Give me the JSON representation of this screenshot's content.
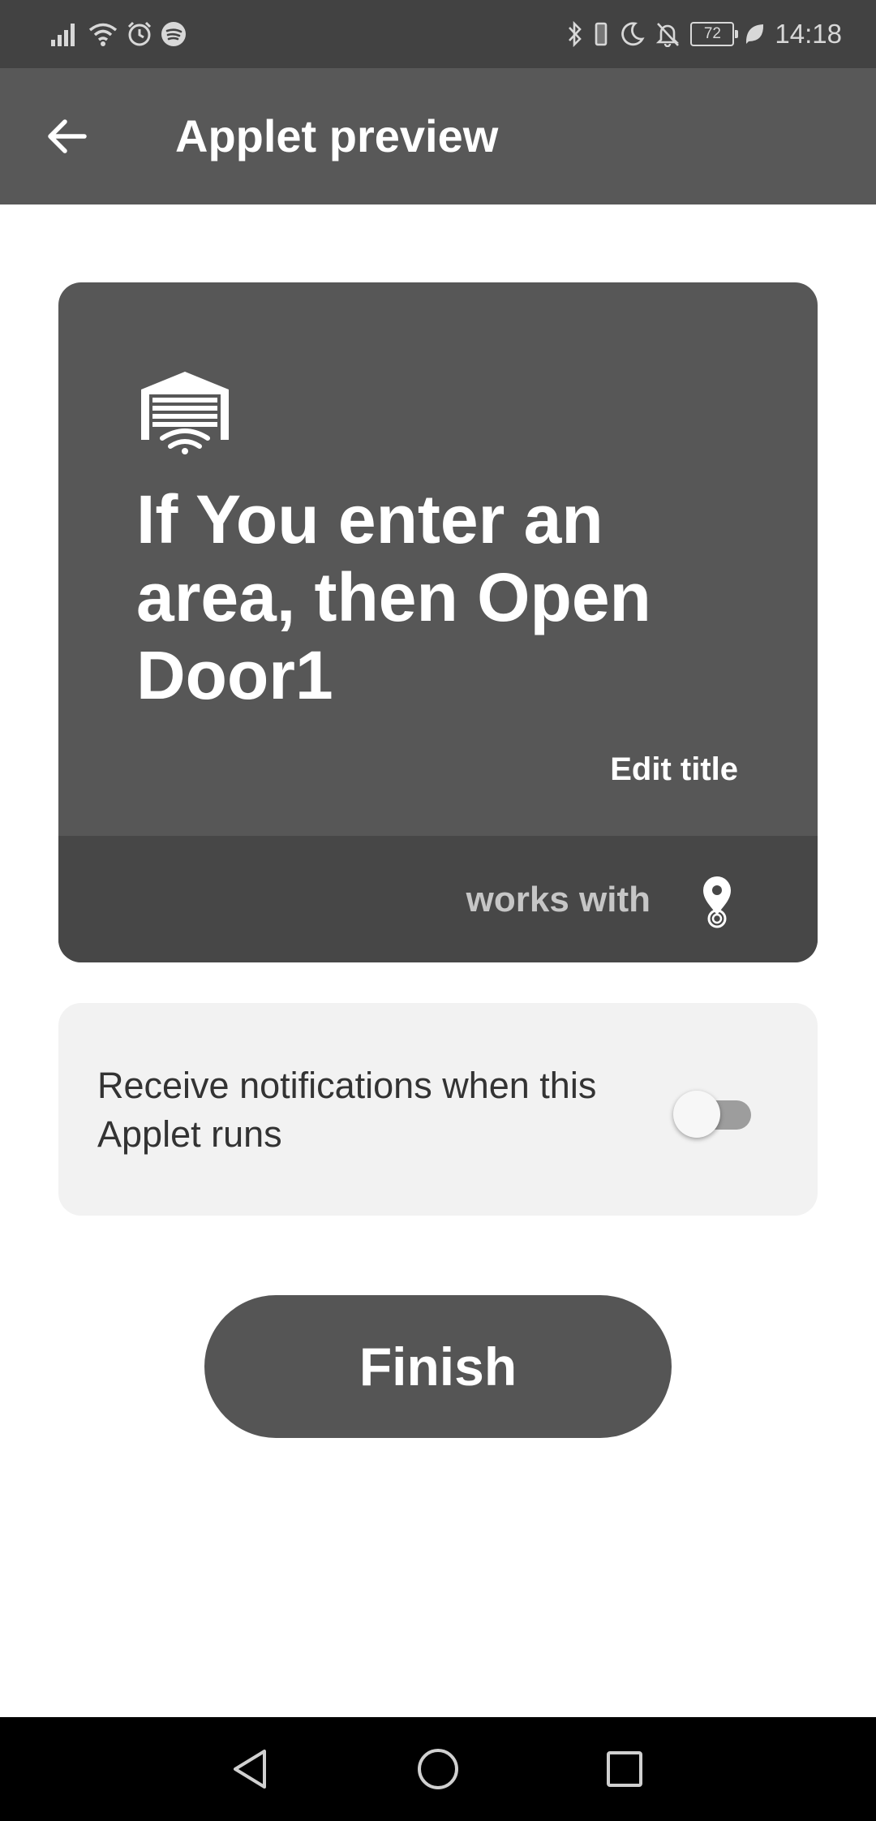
{
  "status_bar": {
    "time": "14:18",
    "battery_level": "72",
    "left_icons": [
      "signal-icon",
      "wifi-icon",
      "alarm-icon",
      "spotify-icon"
    ],
    "right_icons": [
      "bluetooth-icon",
      "vibrate-icon",
      "moon-icon",
      "notifications-off-icon",
      "battery-icon",
      "power-saving-leaf-icon"
    ]
  },
  "app_bar": {
    "title": "Applet preview",
    "back_icon": "arrow-left-icon"
  },
  "applet_card": {
    "service_icon": "garage-door-icon",
    "title": "If You enter an area, then Open Door1",
    "edit_title_label": "Edit title",
    "works_with_label": "works with",
    "works_with_icon": "location-pin-icon"
  },
  "notifications": {
    "label": "Receive notifications when this Applet runs",
    "enabled": false
  },
  "finish_button": {
    "label": "Finish"
  },
  "nav_bar": {
    "buttons": [
      "back-triangle-icon",
      "home-circle-icon",
      "recents-square-icon"
    ]
  },
  "colors": {
    "status_bar_bg": "#424242",
    "app_bar_bg": "#585858",
    "card_bg": "#575757",
    "card_footer_bg": "#474747",
    "notif_bg": "#f2f2f2",
    "button_bg": "#555555",
    "nav_bar_bg": "#000000"
  }
}
